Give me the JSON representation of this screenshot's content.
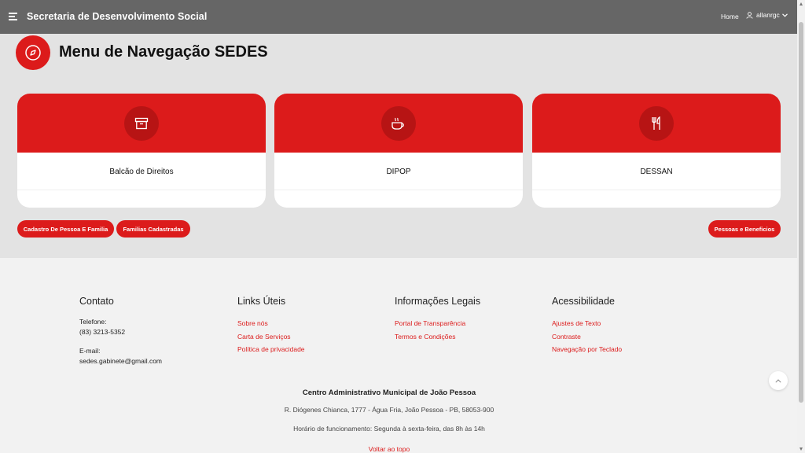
{
  "header": {
    "app_title": "Secretaria de Desenvolvimento Social",
    "home_link": "Home",
    "username": "allanrgc"
  },
  "page": {
    "title": "Menu de Navegação SEDES",
    "icon": "compass-icon"
  },
  "cards": [
    {
      "label": "Balcão de Direitos",
      "icon": "archive-box-icon"
    },
    {
      "label": "DIPOP",
      "icon": "coffee-cup-icon"
    },
    {
      "label": "DESSAN",
      "icon": "fork-knife-icon"
    }
  ],
  "actions": {
    "cadastro": "Cadastro De Pessoa E Familia",
    "familias": "Familias Cadastradas",
    "pessoas": "Pessoas e Beneficios"
  },
  "footer": {
    "contact": {
      "heading": "Contato",
      "phone_label": "Telefone:",
      "phone": "(83) 3213-5352",
      "email_label": "E-mail:",
      "email": "sedes.gabinete@gmail.com"
    },
    "links": {
      "heading": "Links Úteis",
      "items": [
        "Sobre nós",
        "Carta de Serviços",
        "Política de privacidade"
      ]
    },
    "legal": {
      "heading": "Informações Legais",
      "items": [
        "Portal de Transparência",
        "Termos e Condições"
      ]
    },
    "accessibility": {
      "heading": "Acessibilidade",
      "items": [
        "Ajustes de Texto",
        "Contraste",
        "Navegação por Teclado"
      ]
    },
    "center_title": "Centro Administrativo Municipal de João Pessoa",
    "address": "R. Diógenes Chianca, 1777 - Água Fria, João Pessoa - PB, 58053-900",
    "hours": "Horário de funcionamento: Segunda à sexta-feira, das 8h às 14h",
    "back_to_top": "Voltar ao topo"
  },
  "colors": {
    "accent": "#dc1b1b",
    "header_bg": "#666666",
    "main_bg": "#e3e3e3",
    "footer_bg": "#f2f2f2"
  }
}
